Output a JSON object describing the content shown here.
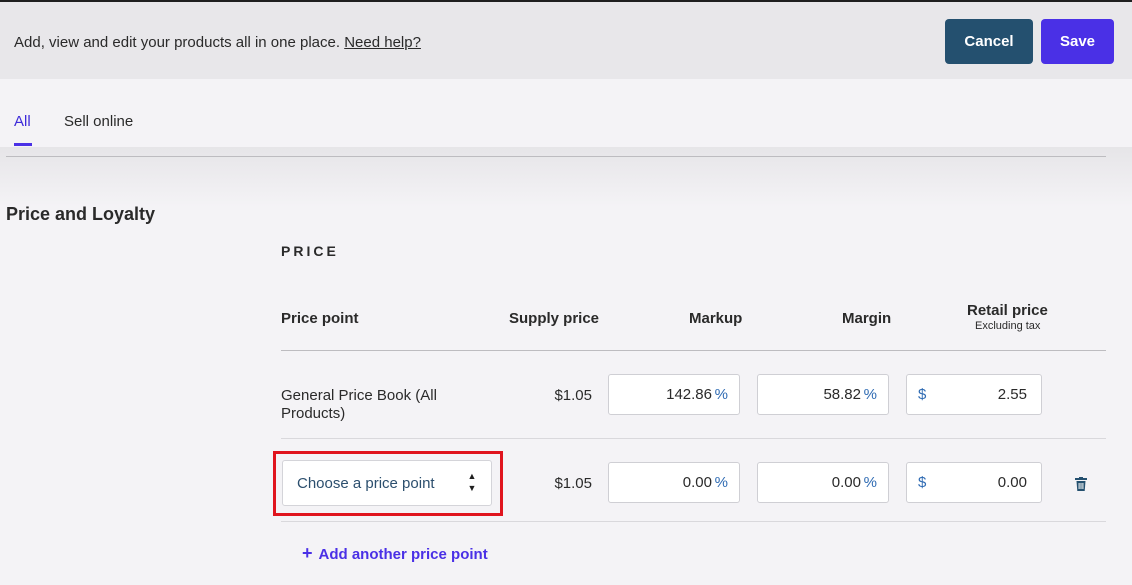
{
  "header": {
    "description": "Add, view and edit your products all in one place.",
    "help_link": "Need help?",
    "cancel_label": "Cancel",
    "save_label": "Save"
  },
  "tabs": [
    {
      "label": "All",
      "active": true
    },
    {
      "label": "Sell online",
      "active": false
    }
  ],
  "section": {
    "title": "Price and Loyalty",
    "price_heading": "PRICE"
  },
  "columns": {
    "price_point": "Price point",
    "supply_price": "Supply price",
    "markup": "Markup",
    "margin": "Margin",
    "retail_price": "Retail price",
    "retail_sub": "Excluding tax"
  },
  "rows": [
    {
      "price_point": "General Price Book (All Products)",
      "supply_price": "$1.05",
      "markup": "142.86",
      "margin": "58.82",
      "retail": "2.55"
    },
    {
      "price_point_placeholder": "Choose a price point",
      "supply_price": "$1.05",
      "markup": "0.00",
      "margin": "0.00",
      "retail": "0.00"
    }
  ],
  "units": {
    "percent": "%",
    "currency": "$"
  },
  "add_price_point": "Add another price point",
  "icons": {
    "trash": "trash-icon",
    "plus": "plus-icon",
    "sort": "sort-arrows-icon"
  },
  "colors": {
    "accent": "#4a30e6",
    "cancel": "#24506f",
    "highlight": "#e0141e"
  }
}
